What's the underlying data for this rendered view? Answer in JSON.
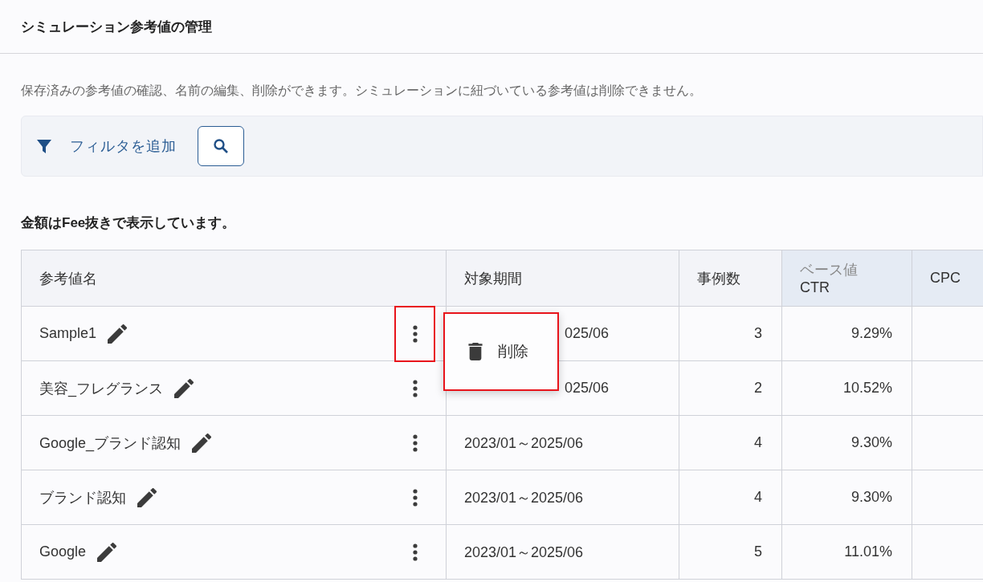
{
  "page": {
    "title": "シミュレーション参考値の管理",
    "description": "保存済みの参考値の確認、名前の編集、削除ができます。シミュレーションに紐づいている参考値は削除できません。"
  },
  "filter_bar": {
    "add_filter": "フィルタを追加"
  },
  "note": "金額はFee抜きで表示しています。",
  "table": {
    "columns": [
      {
        "label": "参考値名"
      },
      {
        "label": "対象期間"
      },
      {
        "label": "事例数"
      },
      {
        "group": "ベース値",
        "label": "CTR"
      },
      {
        "label": "CPC"
      }
    ],
    "rows": [
      {
        "name": "Sample1",
        "period": "025/06",
        "covered": true,
        "cases": "3",
        "ctr": "9.29%",
        "menu_open": true,
        "highlighted": true
      },
      {
        "name": "美容_フレグランス",
        "period": "025/06",
        "covered": true,
        "cases": "2",
        "ctr": "10.52%",
        "menu_open": false,
        "highlighted": false
      },
      {
        "name": "Google_ブランド認知",
        "period": "2023/01～2025/06",
        "covered": false,
        "cases": "4",
        "ctr": "9.30%",
        "menu_open": false,
        "highlighted": false
      },
      {
        "name": "ブランド認知",
        "period": "2023/01～2025/06",
        "covered": false,
        "cases": "4",
        "ctr": "9.30%",
        "menu_open": false,
        "highlighted": false
      },
      {
        "name": "Google",
        "period": "2023/01～2025/06",
        "covered": false,
        "cases": "5",
        "ctr": "11.01%",
        "menu_open": false,
        "highlighted": false
      }
    ]
  },
  "context_menu": {
    "highlighted": true,
    "items": [
      {
        "label": "削除",
        "kind": "delete"
      }
    ]
  }
}
